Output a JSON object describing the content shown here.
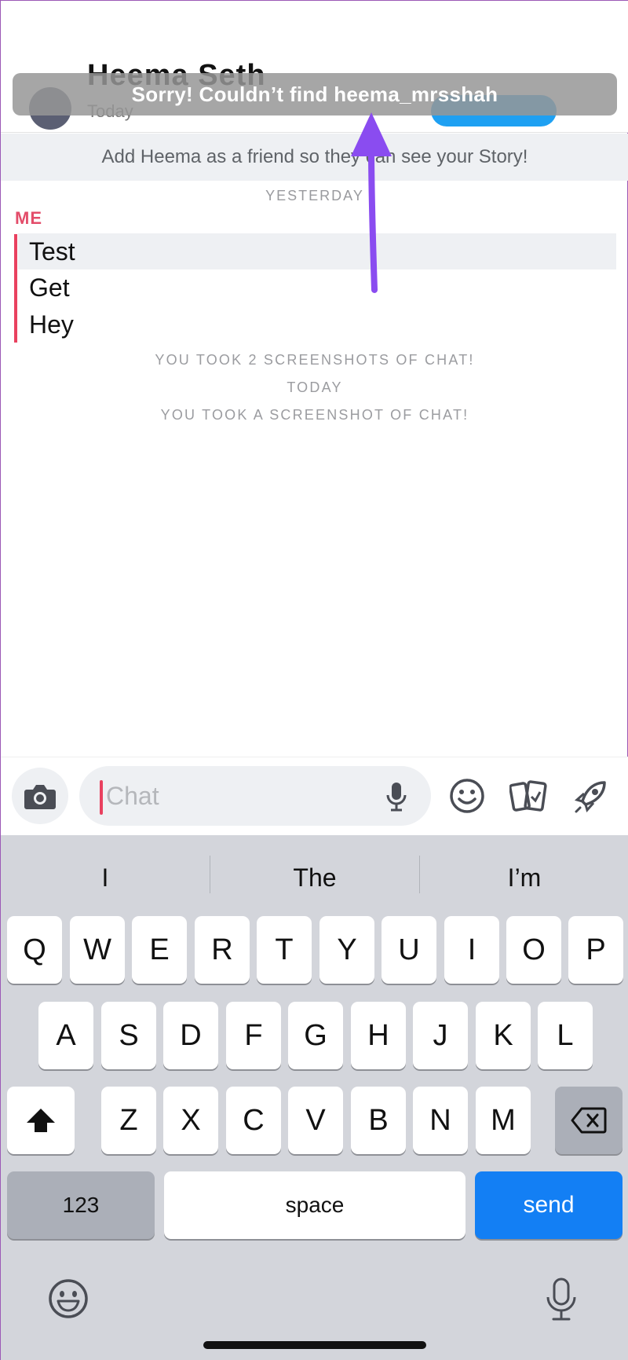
{
  "header": {
    "contact_name": "Heema Seth",
    "subtitle": "Today"
  },
  "toast": {
    "message": "Sorry! Couldn’t find heema_mrsshah"
  },
  "banner": {
    "text": "Add Heema as a friend so they can see your Story!"
  },
  "chat": {
    "day_yesterday": "YESTERDAY",
    "sender_label": "ME",
    "messages": [
      {
        "text": "Test"
      },
      {
        "text": "Get"
      },
      {
        "text": "Hey"
      }
    ],
    "system_lines": [
      "YOU TOOK 2 SCREENSHOTS OF CHAT!",
      "TODAY",
      "YOU TOOK A SCREENSHOT OF CHAT!"
    ]
  },
  "input": {
    "placeholder": "Chat"
  },
  "keyboard": {
    "suggestions": [
      "I",
      "The",
      "I’m"
    ],
    "row1": [
      "Q",
      "W",
      "E",
      "R",
      "T",
      "Y",
      "U",
      "I",
      "O",
      "P"
    ],
    "row2": [
      "A",
      "S",
      "D",
      "F",
      "G",
      "H",
      "J",
      "K",
      "L"
    ],
    "row3": [
      "Z",
      "X",
      "C",
      "V",
      "B",
      "N",
      "M"
    ],
    "numbers_key": "123",
    "space_key": "space",
    "send_key": "send"
  },
  "colors": {
    "accent_red": "#e9415f",
    "send_blue": "#137ff4",
    "annotation_arrow": "#8a4cf0"
  }
}
